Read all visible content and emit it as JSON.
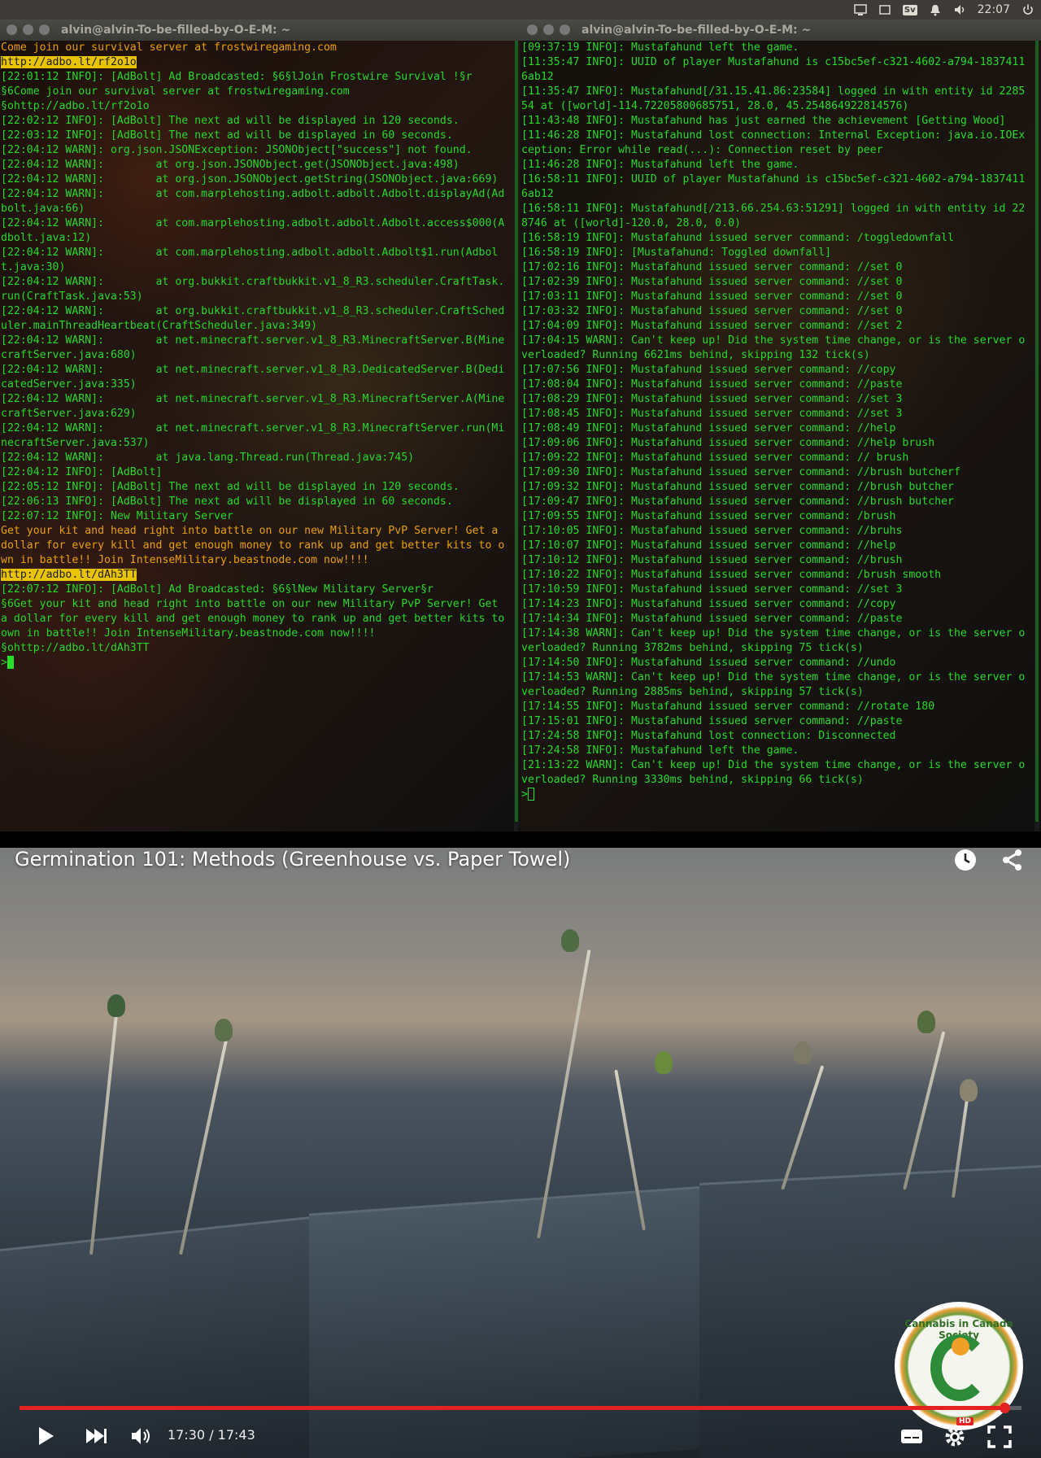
{
  "topbar": {
    "clock": "22:07",
    "keyboard_layout": "Sv",
    "icons": [
      "monitor-icon",
      "window-icon",
      "keyboard-icon",
      "bell-icon",
      "volume-icon",
      "power-icon"
    ]
  },
  "terminal_left": {
    "title": "alvin@alvin-To-be-filled-by-O-E-M: ~",
    "lines": [
      {
        "t": "Come join our survival server at frostwiregaming.com",
        "c": "or"
      },
      {
        "t": "http://adbo.lt/rf2o1o",
        "c": "hl"
      },
      {
        "t": "[22:01:12 INFO]: [AdBolt] Ad Broadcasted: §6§lJoin Frostwire Survival !§r",
        "c": "gr"
      },
      {
        "t": "§6Come join our survival server at frostwiregaming.com",
        "c": "gr"
      },
      {
        "t": "§ohttp://adbo.lt/rf2o1o",
        "c": "gr"
      },
      {
        "t": "[22:02:12 INFO]: [AdBolt] The next ad will be displayed in 120 seconds.",
        "c": "gr"
      },
      {
        "t": "[22:03:12 INFO]: [AdBolt] The next ad will be displayed in 60 seconds.",
        "c": "gr"
      },
      {
        "t": "[22:04:12 WARN]: org.json.JSONException: JSONObject[\"success\"] not found.",
        "c": "gr"
      },
      {
        "t": "[22:04:12 WARN]:        at org.json.JSONObject.get(JSONObject.java:498)",
        "c": "gr"
      },
      {
        "t": "[22:04:12 WARN]:        at org.json.JSONObject.getString(JSONObject.java:669)",
        "c": "gr"
      },
      {
        "t": "[22:04:12 WARN]:        at com.marplehosting.adbolt.adbolt.Adbolt.displayAd(Adbolt.java:66)",
        "c": "gr"
      },
      {
        "t": "[22:04:12 WARN]:        at com.marplehosting.adbolt.adbolt.Adbolt.access$000(Adbolt.java:12)",
        "c": "gr"
      },
      {
        "t": "[22:04:12 WARN]:        at com.marplehosting.adbolt.adbolt.Adbolt$1.run(Adbolt.java:30)",
        "c": "gr"
      },
      {
        "t": "[22:04:12 WARN]:        at org.bukkit.craftbukkit.v1_8_R3.scheduler.CraftTask.run(CraftTask.java:53)",
        "c": "gr"
      },
      {
        "t": "[22:04:12 WARN]:        at org.bukkit.craftbukkit.v1_8_R3.scheduler.CraftScheduler.mainThreadHeartbeat(CraftScheduler.java:349)",
        "c": "gr"
      },
      {
        "t": "[22:04:12 WARN]:        at net.minecraft.server.v1_8_R3.MinecraftServer.B(MinecraftServer.java:680)",
        "c": "gr"
      },
      {
        "t": "[22:04:12 WARN]:        at net.minecraft.server.v1_8_R3.DedicatedServer.B(DedicatedServer.java:335)",
        "c": "gr"
      },
      {
        "t": "[22:04:12 WARN]:        at net.minecraft.server.v1_8_R3.MinecraftServer.A(MinecraftServer.java:629)",
        "c": "gr"
      },
      {
        "t": "[22:04:12 WARN]:        at net.minecraft.server.v1_8_R3.MinecraftServer.run(MinecraftServer.java:537)",
        "c": "gr"
      },
      {
        "t": "[22:04:12 WARN]:        at java.lang.Thread.run(Thread.java:745)",
        "c": "gr"
      },
      {
        "t": "[22:04:12 INFO]: [AdBolt]",
        "c": "gr"
      },
      {
        "t": "[22:05:12 INFO]: [AdBolt] The next ad will be displayed in 120 seconds.",
        "c": "gr"
      },
      {
        "t": "[22:06:13 INFO]: [AdBolt] The next ad will be displayed in 60 seconds.",
        "c": "gr"
      },
      {
        "t": "[22:07:12 INFO]: New Military Server",
        "c": "gr"
      },
      {
        "t": "Get your kit and head right into battle on our new Military PvP Server! Get a dollar for every kill and get enough money to rank up and get better kits to own in battle!! Join IntenseMilitary.beastnode.com now!!!!",
        "c": "or"
      },
      {
        "t": "http://adbo.lt/dAh3TT",
        "c": "hl"
      },
      {
        "t": "[22:07:12 INFO]: [AdBolt] Ad Broadcasted: §6§lNew Military Server§r",
        "c": "gr"
      },
      {
        "t": "§6Get your kit and head right into battle on our new Military PvP Server! Get a dollar for every kill and get enough money to rank up and get better kits to own in battle!! Join IntenseMilitary.beastnode.com now!!!!",
        "c": "gr"
      },
      {
        "t": "§ohttp://adbo.lt/dAh3TT",
        "c": "gr"
      }
    ],
    "prompt": ">"
  },
  "terminal_right": {
    "title": "alvin@alvin-To-be-filled-by-O-E-M: ~",
    "lines": [
      "[09:37:19 INFO]: Mustafahund left the game.",
      "[11:35:47 INFO]: UUID of player Mustafahund is c15bc5ef-c321-4602-a794-18374116ab12",
      "[11:35:47 INFO]: Mustafahund[/31.15.41.86:23584] logged in with entity id 228554 at ([world]-114.72205800685751, 28.0, 45.254864922814576)",
      "[11:43:48 INFO]: Mustafahund has just earned the achievement [Getting Wood]",
      "[11:46:28 INFO]: Mustafahund lost connection: Internal Exception: java.io.IOException: Error while read(...): Connection reset by peer",
      "[11:46:28 INFO]: Mustafahund left the game.",
      "[16:58:11 INFO]: UUID of player Mustafahund is c15bc5ef-c321-4602-a794-18374116ab12",
      "[16:58:11 INFO]: Mustafahund[/213.66.254.63:51291] logged in with entity id 228746 at ([world]-120.0, 28.0, 0.0)",
      "[16:58:19 INFO]: Mustafahund issued server command: /toggledownfall",
      "[16:58:19 INFO]: [Mustafahund: Toggled downfall]",
      "[17:02:16 INFO]: Mustafahund issued server command: //set 0",
      "[17:02:39 INFO]: Mustafahund issued server command: //set 0",
      "[17:03:11 INFO]: Mustafahund issued server command: //set 0",
      "[17:03:32 INFO]: Mustafahund issued server command: //set 0",
      "[17:04:09 INFO]: Mustafahund issued server command: //set 2",
      "[17:04:15 WARN]: Can't keep up! Did the system time change, or is the server overloaded? Running 6621ms behind, skipping 132 tick(s)",
      "[17:07:56 INFO]: Mustafahund issued server command: //copy",
      "[17:08:04 INFO]: Mustafahund issued server command: //paste",
      "[17:08:29 INFO]: Mustafahund issued server command: //set 3",
      "[17:08:45 INFO]: Mustafahund issued server command: //set 3",
      "[17:08:49 INFO]: Mustafahund issued server command: //help",
      "[17:09:06 INFO]: Mustafahund issued server command: //help brush",
      "[17:09:22 INFO]: Mustafahund issued server command: // brush",
      "[17:09:30 INFO]: Mustafahund issued server command: //brush butcherf",
      "[17:09:32 INFO]: Mustafahund issued server command: //brush butcher",
      "[17:09:47 INFO]: Mustafahund issued server command: //brush butcher",
      "[17:09:55 INFO]: Mustafahund issued server command: /brush",
      "[17:10:05 INFO]: Mustafahund issued server command: //bruhs",
      "[17:10:07 INFO]: Mustafahund issued server command: //help",
      "[17:10:12 INFO]: Mustafahund issued server command: //brush",
      "[17:10:22 INFO]: Mustafahund issued server command: /brush smooth",
      "[17:10:59 INFO]: Mustafahund issued server command: //set 3",
      "[17:14:23 INFO]: Mustafahund issued server command: //copy",
      "[17:14:34 INFO]: Mustafahund issued server command: //paste",
      "[17:14:38 WARN]: Can't keep up! Did the system time change, or is the server overloaded? Running 3782ms behind, skipping 75 tick(s)",
      "[17:14:50 INFO]: Mustafahund issued server command: //undo",
      "[17:14:53 WARN]: Can't keep up! Did the system time change, or is the server overloaded? Running 2885ms behind, skipping 57 tick(s)",
      "[17:14:55 INFO]: Mustafahund issued server command: //rotate 180",
      "[17:15:01 INFO]: Mustafahund issued server command: //paste",
      "[17:24:58 INFO]: Mustafahund lost connection: Disconnected",
      "[17:24:58 INFO]: Mustafahund left the game.",
      "[21:13:22 WARN]: Can't keep up! Did the system time change, or is the server overloaded? Running 3330ms behind, skipping 66 tick(s)"
    ],
    "prompt": ">"
  },
  "video": {
    "title": "Germination 101: Methods (Greenhouse vs. Paper Towel)",
    "time": "17:30 / 17:43",
    "progress_fraction": 0.983,
    "channel_logo_text": "Cannabis in Canada Society",
    "hd_badge": "HD",
    "accent_color": "#e52222"
  }
}
